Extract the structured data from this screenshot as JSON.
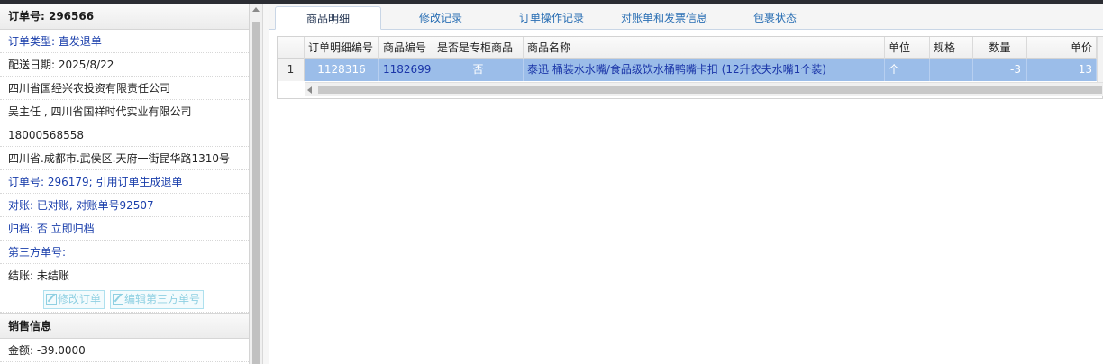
{
  "order": {
    "title": "订单号: 296566",
    "fields": [
      "订单类型: 直发退单",
      "配送日期: 2025/8/22",
      "四川省国经兴农投资有限责任公司",
      "吴主任 , 四川省国祥时代实业有限公司",
      "18000568558",
      "四川省.成都市.武侯区.天府一街昆华路1310号",
      "订单号: 296179; 引用订单生成退单",
      "对账: 已对账, 对账单号92507",
      "归档:  否 立即归档",
      "第三方单号:",
      "结账: 未结账"
    ],
    "buttons": {
      "edit_order": "修改订单",
      "edit_third": "编辑第三方单号"
    }
  },
  "sales": {
    "title": "销售信息",
    "amount": "金额: -39.0000"
  },
  "tabs": [
    "商品明细",
    "修改记录",
    "订单操作记录",
    "对账单和发票信息",
    "包裹状态"
  ],
  "grid": {
    "headers": [
      "订单明细编号",
      "商品编号",
      "是否是专柜商品",
      "商品名称",
      "单位",
      "规格",
      "数量",
      "单价"
    ],
    "rows": [
      {
        "rownum": "1",
        "detail_id": "1128316",
        "product_id": "1182699",
        "counter": "否",
        "name": "泰迅 桶装水水嘴/食品级饮水桶鸭嘴卡扣 (12升农夫水嘴1个装)",
        "unit": "个",
        "spec": "",
        "qty": "-3",
        "price": "13"
      }
    ]
  },
  "colors": {
    "selected_row": "#9bbde9",
    "tab_text": "#2a6fb4",
    "link_blue": "#1a3eab"
  }
}
